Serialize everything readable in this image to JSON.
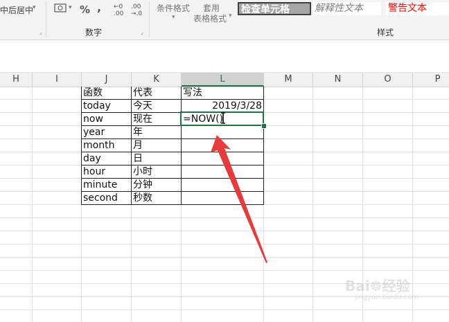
{
  "ribbon": {
    "merge_center_partial": "中后居中",
    "number_format_dropdown_icon": "currency-icon",
    "percent": "%",
    "comma": ",",
    "increase_decimal": ".00→.0",
    "decrease_decimal": ".00",
    "conditional_format": "条件格式",
    "table_format_line1": "套用",
    "table_format_line2": "表格格式",
    "group_number": "数字",
    "group_styles": "样式",
    "styles": [
      {
        "label": "检查单元格",
        "bg": "#a5a5a5",
        "color": "#ffffff"
      },
      {
        "label": "解释性文本",
        "bg": "#ffffff",
        "color": "#7f7f7f"
      },
      {
        "label": "警告文本",
        "bg": "#ffffff",
        "color": "#ff0000"
      }
    ]
  },
  "columns": [
    "H",
    "I",
    "J",
    "K",
    "L",
    "M",
    "N",
    "O",
    "P"
  ],
  "table": {
    "rows": [
      [
        "函数",
        "代表",
        "写法"
      ],
      [
        "today",
        "今天",
        "2019/3/28"
      ],
      [
        "now",
        "现在",
        "=NOW()"
      ],
      [
        "year",
        "年",
        ""
      ],
      [
        "month",
        "月",
        ""
      ],
      [
        "day",
        "日",
        ""
      ],
      [
        "hour",
        "小时",
        ""
      ],
      [
        "minute",
        "分钟",
        ""
      ],
      [
        "second",
        "秒数",
        ""
      ]
    ]
  },
  "colors": {
    "selection": "#217346",
    "arrow": "#e8393b"
  }
}
